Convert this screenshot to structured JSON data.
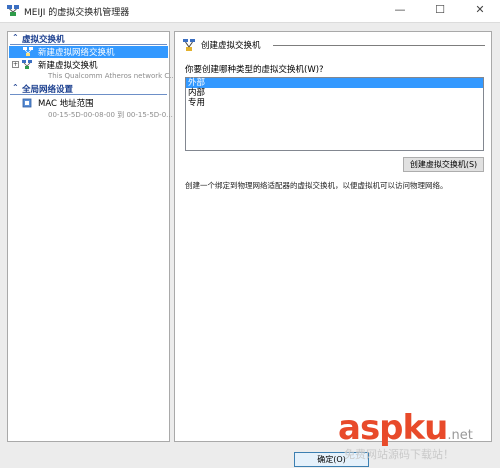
{
  "window": {
    "title": "MEIJI 的虚拟交换机管理器",
    "controls": {
      "minimize": "—",
      "maximize": "☐",
      "close": "✕"
    }
  },
  "sidebar": {
    "sections": [
      {
        "label": "虚拟交换机",
        "chevron": "⌃"
      },
      {
        "label": "全局网络设置",
        "chevron": "⌃"
      }
    ],
    "items": [
      {
        "label": "新建虚拟网络交换机",
        "selected": true,
        "icon": "new-switch-icon"
      },
      {
        "label": "新建虚拟交换机",
        "sub": "This Qualcomm Atheros network C...",
        "expander": "+",
        "icon": "network-switch-icon"
      },
      {
        "label": "MAC 地址范围",
        "sub": "00-15-5D-00-08-00 到 00-15-5D-0...",
        "icon": "mac-address-icon"
      }
    ]
  },
  "main": {
    "group_title": "创建虚拟交换机",
    "question": "你要创建哪种类型的虚拟交换机(W)?",
    "switch_types": [
      {
        "label": "外部",
        "selected": true
      },
      {
        "label": "内部",
        "selected": false
      },
      {
        "label": "专用",
        "selected": false
      }
    ],
    "create_button": "创建虚拟交换机(S)",
    "description": "创建一个绑定到物理网络适配器的虚拟交换机，以便虚拟机可以访问物理网络。"
  },
  "footer": {
    "ok_button": "确定(O)"
  },
  "watermark": {
    "brand": "aspku",
    "domain": ".net",
    "subtitle": "免费网站源码下载站！"
  },
  "colors": {
    "selection": "#3399ff",
    "section_header": "#1b3f8f",
    "watermark_red": "#e84a2a",
    "watermark_blue": "#2b83d6"
  }
}
